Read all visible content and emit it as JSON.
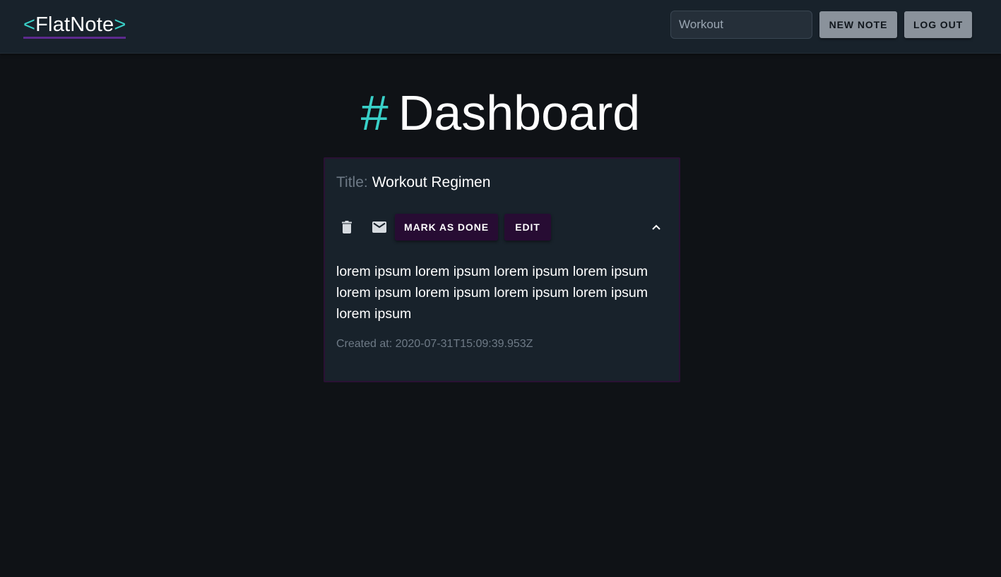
{
  "appbar": {
    "logo_open": "<",
    "logo_name": "FlatNote",
    "logo_close": ">",
    "search": {
      "value": "Workout",
      "placeholder": ""
    },
    "new_note_label": "NEW NOTE",
    "logout_label": "LOG OUT"
  },
  "page": {
    "title_hash": "#",
    "title": "Dashboard"
  },
  "note": {
    "title_label": "Title:",
    "title": "Workout Regimen",
    "mark_done_label": "MARK AS DONE",
    "edit_label": "EDIT",
    "body": "lorem ipsum lorem ipsum lorem ipsum lorem ipsum lorem ipsum lorem ipsum lorem ipsum lorem ipsum lorem ipsum",
    "created_at": "Created at: 2020-07-31T15:09:39.953Z",
    "icons": {
      "delete": "trash-icon",
      "email": "mail-icon",
      "collapse": "chevron-up-icon"
    }
  },
  "colors": {
    "accent_teal": "#39d0c8",
    "accent_purple": "#5d2a8e",
    "button_purple": "#270c33",
    "button_grey": "#8a929b",
    "background": "#0f1216",
    "surface": "#18222b"
  }
}
